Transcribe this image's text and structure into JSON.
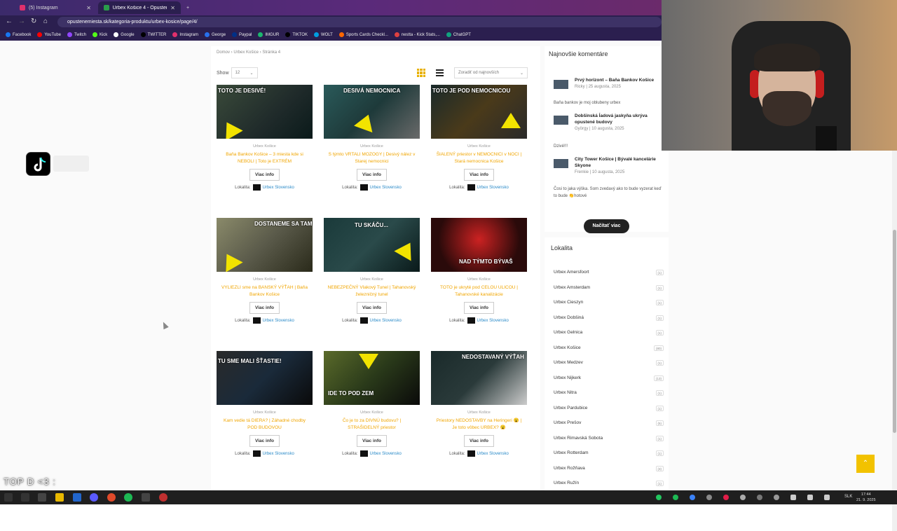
{
  "browser": {
    "tabs": [
      {
        "label": "(5) Instagram",
        "active": false
      },
      {
        "label": "Urbex Košice 4 - Opustené Mie...",
        "active": true
      }
    ],
    "url": "opustenemiesta.sk/kategoria-produktu/urbex-kosice/page/4/",
    "bookmarks": [
      {
        "label": "Facebook",
        "color": "#1877f2"
      },
      {
        "label": "YouTube",
        "color": "#ff0000"
      },
      {
        "label": "Twitch",
        "color": "#9146ff"
      },
      {
        "label": "Kick",
        "color": "#53fc18"
      },
      {
        "label": "Google",
        "color": "#ffffff"
      },
      {
        "label": "TWITTER",
        "color": "#000000"
      },
      {
        "label": "Instagram",
        "color": "#e1306c"
      },
      {
        "label": "George",
        "color": "#2870ed"
      },
      {
        "label": "Paypal",
        "color": "#003087"
      },
      {
        "label": "IMGUR",
        "color": "#1bb76e"
      },
      {
        "label": "TIKTOK",
        "color": "#000000"
      },
      {
        "label": "WOLT",
        "color": "#009de0"
      },
      {
        "label": "Sports Cards Checkl...",
        "color": "#ff6600"
      },
      {
        "label": "nestta - Kick Stats,...",
        "color": "#e04040"
      },
      {
        "label": "ChatGPT",
        "color": "#10a37f"
      }
    ]
  },
  "page": {
    "breadcrumb": "Domov › Urbex Košice › Stránka 4",
    "show_label": "Show",
    "show_value": "12",
    "sort_value": "Zoradiť od najnovších",
    "products": [
      {
        "caption": "TOTO JE DESIVÉ!",
        "category": "Urbex Košice",
        "title": "Baňa Bankov Košice – 3 miesta kde si NEBOLI | Toto je EXTRÉM",
        "btn": "Viac info",
        "loc_label": "Lokalita:",
        "loc_link": "Urbex Slovensko"
      },
      {
        "caption": "DESIVÁ NEMOCNICA",
        "category": "Urbex Košice",
        "title": "S týmto VRTALI MOZOGY | Desivý nález v Starej nemocnici",
        "btn": "Viac info",
        "loc_label": "Lokalita:",
        "loc_link": "Urbex Slovensko"
      },
      {
        "caption": "TOTO JE POD NEMOCNICOU",
        "category": "Urbex Košice",
        "title": "ŠIALENÝ priestor v NEMOCNICI v NOCI | Stará nemocnica Košice",
        "btn": "Viac info",
        "loc_label": "Lokalita:",
        "loc_link": "Urbex Slovensko"
      },
      {
        "caption": "DOSTANEME SA TAM?",
        "category": "Urbex Košice",
        "title": "VYLIEZLI sme na BANSKÝ VÝŤAH | Baňa Bankov Košice",
        "btn": "Viac info",
        "loc_label": "Lokalita:",
        "loc_link": "Urbex Slovensko"
      },
      {
        "caption": "TU SKÁČU...",
        "category": "Urbex Košice",
        "title": "NEBEZPEČNÝ Vlakový Tunel | Tahanovský železničný tunel",
        "btn": "Viac info",
        "loc_label": "Lokalita:",
        "loc_link": "Urbex Slovensko"
      },
      {
        "caption": "NAD TÝMTO BÝVAŠ",
        "category": "Urbex Košice",
        "title": "TOTO je ukryté pod CELOU ULICOU | Tahanovské kanalizácie",
        "btn": "Viac info",
        "loc_label": "Lokalita:",
        "loc_link": "Urbex Slovensko"
      },
      {
        "caption": "TU SME MALI ŠŤASTIE!",
        "category": "Urbex Košice",
        "title": "Kam vedie tá DIERA? | Záhadné chodby POD BUDOVOU",
        "btn": "Viac info",
        "loc_label": "Lokalita:",
        "loc_link": "Urbex Slovensko"
      },
      {
        "caption": "IDE TO POD ZEM",
        "category": "Urbex Košice",
        "title": "Čo je to za DIVNÚ budovu? | STRAŠIDELNÝ priestor",
        "btn": "Viac info",
        "loc_label": "Lokalita:",
        "loc_link": "Urbex Slovensko"
      },
      {
        "caption": "NEDOSTAVANÝ VÝŤAH",
        "category": "Urbex Košice",
        "title": "Priestory NEDOSTAVBY na Heringeri 😮 | Je toto vôbec URBEX? 😮",
        "btn": "Viac info",
        "loc_label": "Lokalita:",
        "loc_link": "Urbex Slovensko"
      }
    ]
  },
  "sidebar": {
    "comments_title": "Najnovšie komentáre",
    "comments": [
      {
        "title": "Prvý horizont – Baňa Bankov Košice",
        "author": "Ricky",
        "date": "25 augusta, 2025",
        "excerpt": "Baňa bankov je moj oblubeny urbex"
      },
      {
        "title": "Dobšinská ĺadová jaskyňa ukrýva opustené budovy",
        "author": "György",
        "date": "10 augusta, 2025",
        "excerpt": "Dzivé!!!"
      },
      {
        "title": "City Tower Košice | Bývalé kancelárie Skyone",
        "author": "Frenkie",
        "date": "10 augusta, 2025",
        "excerpt": "Čosi to jaka výška. Som zvedavý ako to bude vyzerat keď to bude 👏hotové"
      }
    ],
    "load_more": "Načítať viac",
    "locations_title": "Lokalita",
    "locations": [
      {
        "name": "Urbex Amersfoort",
        "count": "(1)"
      },
      {
        "name": "Urbex Amsterdam",
        "count": "(1)"
      },
      {
        "name": "Urbex Cieszyn",
        "count": "(1)"
      },
      {
        "name": "Urbex Dobšiná",
        "count": "(1)"
      },
      {
        "name": "Urbex Gelnica",
        "count": "(1)"
      },
      {
        "name": "Urbex Košice",
        "count": "(80)"
      },
      {
        "name": "Urbex Medzev",
        "count": "(1)"
      },
      {
        "name": "Urbex Nijkerk",
        "count": "(13)"
      },
      {
        "name": "Urbex Nitra",
        "count": "(1)"
      },
      {
        "name": "Urbex Pardubice",
        "count": "(1)"
      },
      {
        "name": "Urbex Prešov",
        "count": "(5)"
      },
      {
        "name": "Urbex Rimavská Sobota",
        "count": "(1)"
      },
      {
        "name": "Urbex Rotterdam",
        "count": "(1)"
      },
      {
        "name": "Urbex Rožňava",
        "count": "(3)"
      },
      {
        "name": "Urbex Ružín",
        "count": "(1)"
      }
    ]
  },
  "overlay": {
    "text": "TOP D <3 :"
  },
  "taskbar": {
    "lang": "SLK",
    "time": "17:44",
    "date": "21. 9. 2025"
  }
}
